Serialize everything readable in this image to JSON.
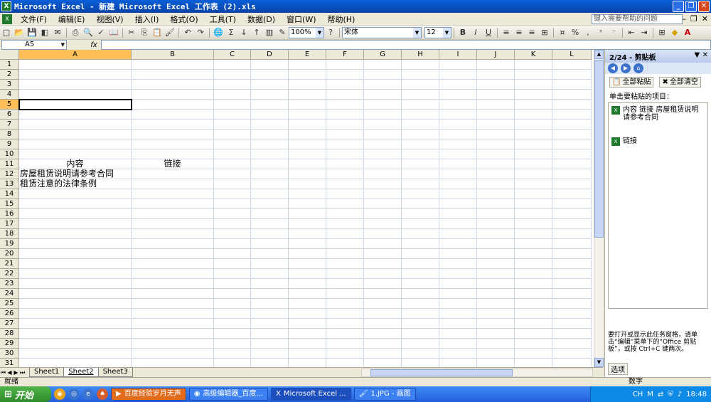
{
  "window": {
    "title": "Microsoft Excel - 新建 Microsoft Excel 工作表 (2).xls",
    "app_icon": "X"
  },
  "menu": {
    "items": [
      "文件(F)",
      "编辑(E)",
      "视图(V)",
      "插入(I)",
      "格式(O)",
      "工具(T)",
      "数据(D)",
      "窗口(W)",
      "帮助(H)"
    ],
    "help_placeholder": "键入需要帮助的问题"
  },
  "toolbar": {
    "zoom": "100%",
    "font": "宋体",
    "font_size": "12",
    "bold": "B",
    "italic": "I",
    "underline": "U",
    "sigma": "Σ",
    "percent": "%"
  },
  "formula_bar": {
    "name_box": "A5",
    "fx": "fx",
    "content": ""
  },
  "grid": {
    "columns": [
      "A",
      "B",
      "C",
      "D",
      "E",
      "F",
      "G",
      "H",
      "I",
      "J",
      "K",
      "L"
    ],
    "selected_column": "A",
    "active_row": 5,
    "row_count": 31,
    "cells": {
      "A11": "内容",
      "B11": "链接",
      "A12": "房屋租赁说明请参考合同",
      "A13": "租赁注意的法律条例"
    }
  },
  "sheets": {
    "tabs": [
      "Sheet1",
      "Sheet2",
      "Sheet3"
    ],
    "active": "Sheet2"
  },
  "status": {
    "left": "就绪",
    "right": "数字"
  },
  "taskpane": {
    "title": "2/24 - 剪贴板",
    "paste_all": "全部粘贴",
    "clear_all": "全部清空",
    "label": "单击要粘贴的项目：",
    "items": [
      {
        "text": "内容 链接 房屋租赁说明请参考合同"
      },
      {
        "text": "链接"
      }
    ],
    "footer": "要打开或显示此任务窗格，请单击“编辑”菜单下的“Office 剪贴板”，或按 Ctrl+C 键两次。",
    "options": "选项"
  },
  "taskbar": {
    "start": "开始",
    "buttons": [
      {
        "label": "百度经验岁月无声",
        "style": "orange"
      },
      {
        "label": "高级编辑器_百度...",
        "style": "normal"
      },
      {
        "label": "Microsoft Excel ...",
        "style": "active"
      },
      {
        "label": "1.JPG - 画图",
        "style": "normal"
      }
    ],
    "lang": "CH",
    "clock": "18:48"
  }
}
